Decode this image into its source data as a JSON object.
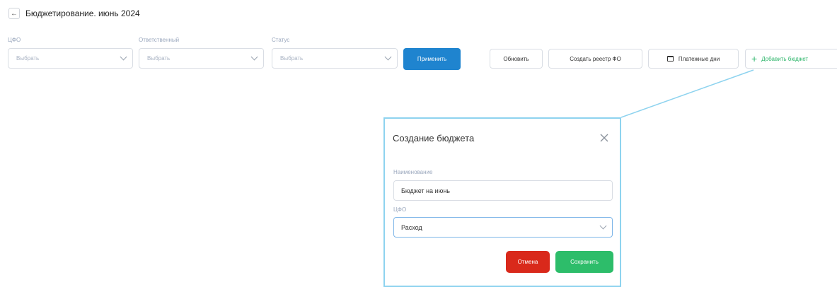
{
  "header": {
    "back_icon": "arrow-left-icon",
    "title": "Бюджетирование. июнь 2024"
  },
  "filters": [
    {
      "label": "ЦФО",
      "placeholder": "Выбрать"
    },
    {
      "label": "Ответственный",
      "placeholder": "Выбрать"
    },
    {
      "label": "Статус",
      "placeholder": "Выбрать"
    }
  ],
  "toolbar": {
    "apply_label": "Применить",
    "refresh_label": "Обновить",
    "create_registry_label": "Создать реестр ФО",
    "payment_days_label": "Платежные дни",
    "add_budget_label": "Добавить бюджет"
  },
  "modal": {
    "title": "Создание бюджета",
    "name_label": "Наименование",
    "name_value": "Бюджет на июнь",
    "cfo_label": "ЦФО",
    "cfo_value": "Расход",
    "cancel_label": "Отмена",
    "save_label": "Сохранить"
  },
  "colors": {
    "primary": "#1f84cf",
    "accent_green": "#2dbd6a",
    "danger": "#d9291b",
    "highlight": "#8ed3ef"
  }
}
